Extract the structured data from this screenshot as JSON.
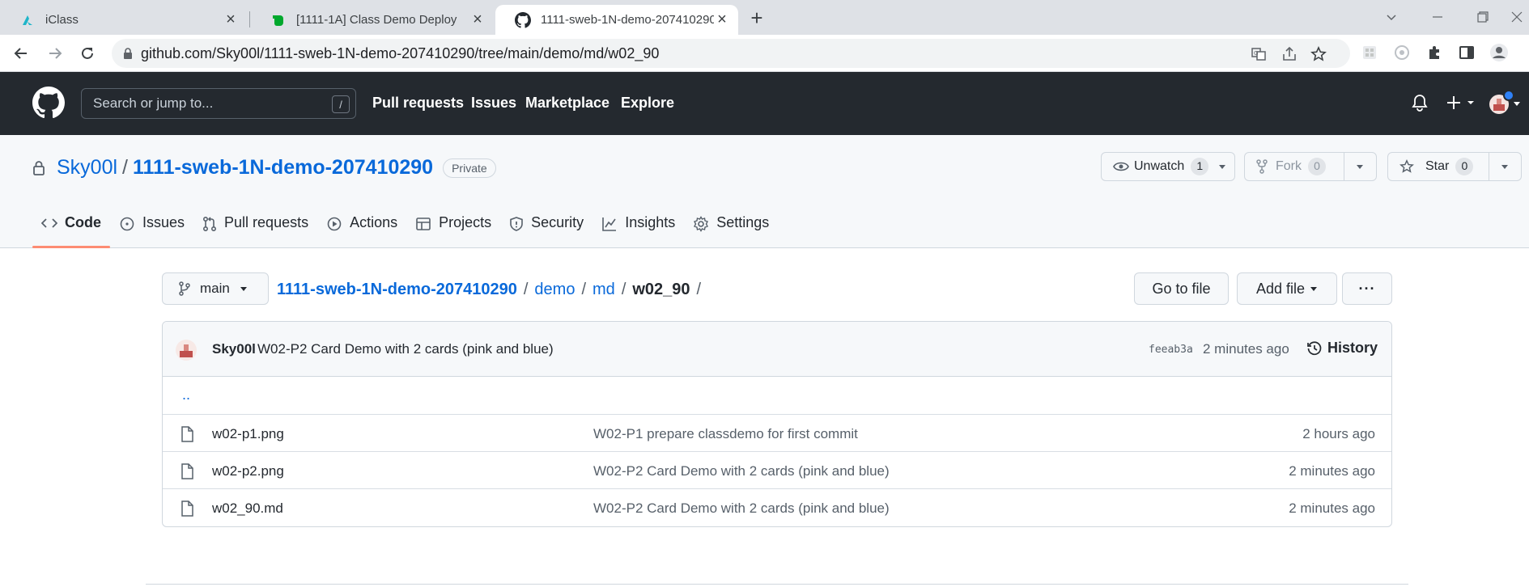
{
  "browser": {
    "tabs": [
      {
        "title": "iClass",
        "icon": "iclass-icon",
        "active": false
      },
      {
        "title": "[1111-1A] Class Demo Deploy",
        "icon": "evernote-icon",
        "active": false
      },
      {
        "title": "1111-sweb-1N-demo-207410290",
        "icon": "github-icon",
        "active": true
      }
    ],
    "url": "github.com/Sky00l/1111-sweb-1N-demo-207410290/tree/main/demo/md/w02_90"
  },
  "gh_header": {
    "search_placeholder": "Search or jump to...",
    "search_shortcut": "/",
    "nav": [
      "Pull requests",
      "Issues",
      "Marketplace",
      "Explore"
    ]
  },
  "repo": {
    "owner": "Sky00l",
    "name": "1111-sweb-1N-demo-207410290",
    "visibility": "Private",
    "watch": {
      "label": "Unwatch",
      "count": "1"
    },
    "fork": {
      "label": "Fork",
      "count": "0"
    },
    "star": {
      "label": "Star",
      "count": "0"
    },
    "tabs": [
      "Code",
      "Issues",
      "Pull requests",
      "Actions",
      "Projects",
      "Security",
      "Insights",
      "Settings"
    ],
    "active_tab": "Code"
  },
  "browser_panel": {
    "branch": "main",
    "breadcrumb": {
      "root": "1111-sweb-1N-demo-207410290",
      "parts": [
        "demo",
        "md"
      ],
      "current": "w02_90"
    },
    "go_to_file": "Go to file",
    "add_file": "Add file",
    "more": "···"
  },
  "latest_commit": {
    "author": "Sky00l",
    "message": "W02-P2 Card Demo with 2 cards (pink and blue)",
    "sha": "feeab3a",
    "time": "2 minutes ago",
    "history_label": "History"
  },
  "parent_link": "..",
  "files": [
    {
      "name": "w02-p1.png",
      "message": "W02-P1 prepare classdemo for first commit",
      "age": "2 hours ago"
    },
    {
      "name": "w02-p2.png",
      "message": "W02-P2 Card Demo with 2 cards (pink and blue)",
      "age": "2 minutes ago"
    },
    {
      "name": "w02_90.md",
      "message": "W02-P2 Card Demo with 2 cards (pink and blue)",
      "age": "2 minutes ago"
    }
  ],
  "colors": {
    "header_bg": "#24292f",
    "link": "#0969da",
    "active_tab_underline": "#fd8c73"
  }
}
